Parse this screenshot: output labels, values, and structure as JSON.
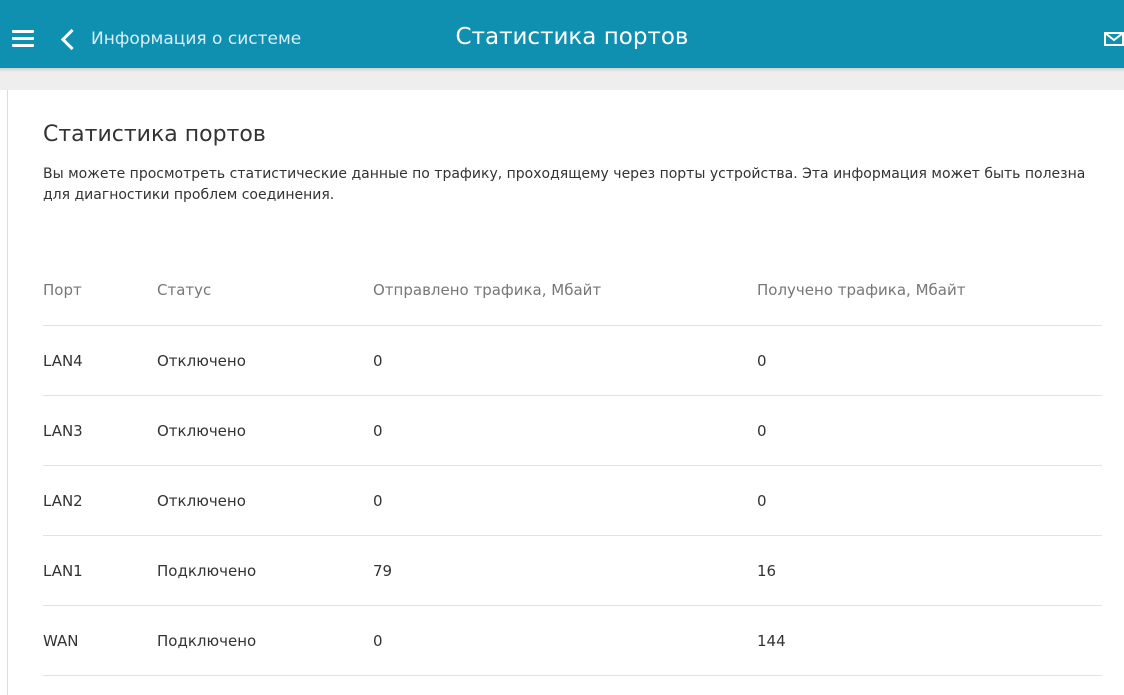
{
  "header": {
    "back_label": "Информация о системе",
    "title": "Статистика портов",
    "background_color": "#1090b0"
  },
  "main": {
    "title": "Статистика портов",
    "description": "Вы можете просмотреть статистические данные по трафику, проходящему через порты устройства. Эта информация может быть полезна для диагностики проблем соединения.",
    "columns": {
      "port": "Порт",
      "status": "Статус",
      "sent": "Отправлено трафика, Мбайт",
      "received": "Получено трафика, Мбайт"
    },
    "rows": [
      {
        "port": "LAN4",
        "status": "Отключено",
        "sent": "0",
        "received": "0"
      },
      {
        "port": "LAN3",
        "status": "Отключено",
        "sent": "0",
        "received": "0"
      },
      {
        "port": "LAN2",
        "status": "Отключено",
        "sent": "0",
        "received": "0"
      },
      {
        "port": "LAN1",
        "status": "Подключено",
        "sent": "79",
        "received": "16"
      },
      {
        "port": "WAN",
        "status": "Подключено",
        "sent": "0",
        "received": "144"
      }
    ]
  },
  "colors": {
    "status_disconnected": "#dd2c00",
    "status_connected": "#2e8b1e"
  },
  "icons": [
    "menu-icon",
    "chevron-left-icon",
    "mail-icon"
  ]
}
